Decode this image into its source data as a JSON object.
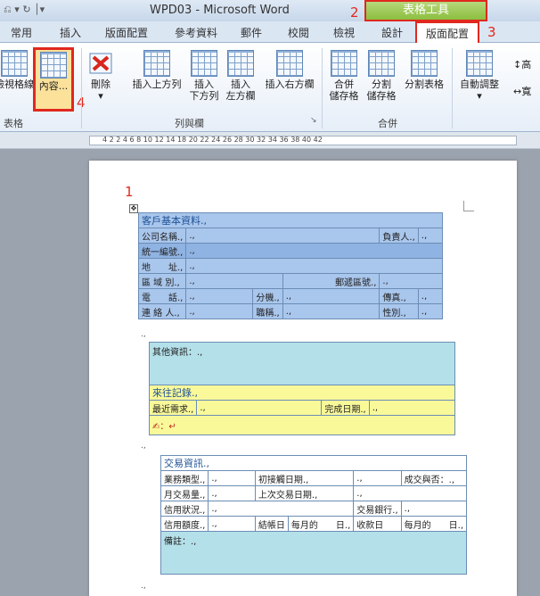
{
  "window": {
    "quick_access": "⎌ ▾ ↻ │▾",
    "title": "WPD03 - Microsoft Word",
    "tool_group_title": "表格工具"
  },
  "tabs": [
    {
      "label": "常用"
    },
    {
      "label": "插入"
    },
    {
      "label": "版面配置"
    },
    {
      "label": "參考資料"
    },
    {
      "label": "郵件"
    },
    {
      "label": "校閱"
    },
    {
      "label": "檢視"
    },
    {
      "label": "設計"
    },
    {
      "label": "版面配置"
    }
  ],
  "ribbon": {
    "view_gridlines": "檢視格線",
    "cell_content": "內容...",
    "delete": "刪除",
    "insert_above": "插入上方列",
    "insert_below_1": "插入",
    "insert_below_2": "下方列",
    "insert_left_1": "插入",
    "insert_left_2": "左方欄",
    "insert_right": "插入右方欄",
    "merge_1": "合併",
    "merge_2": "儲存格",
    "split_1": "分割",
    "split_2": "儲存格",
    "split_table": "分割表格",
    "autofit": "自動調整",
    "right_1": "高",
    "right_2": "寬",
    "group_table": "表格",
    "group_rows_cols": "列與欄",
    "group_merge": "合併"
  },
  "markers": {
    "m1": "1",
    "m2": "2",
    "m3": "3",
    "m4": "4"
  },
  "ruler": {
    "numbers": "4   2        2   4   6   8   10  12  14      18  20  22  24  26  28  30  32  34  36  38  40  42"
  },
  "doc": {
    "table1": {
      "title": "客戶基本資料.,",
      "company": "公司名稱.,",
      "owner": "負責人.,",
      "taxid": "統一編號.,",
      "address": "地　　址.,",
      "region": "區  域  別.,",
      "zip": "郵遞區號.,",
      "phone": "電　　話.,",
      "ext": "分機.,",
      "fax": "傳真.,",
      "contact": "連  絡  人.,",
      "title_job": "職稱.,",
      "gender": "性別.,",
      "cell": ".,"
    },
    "table2": {
      "other": "其他資訊：.,",
      "records": "來往記錄.,",
      "recent": "最近需求.,",
      "done_date": "完成日期.,",
      "note": "✍：↵",
      "cell": ".,"
    },
    "table3": {
      "title": "交易資訊.,",
      "biz_type": "業務類型.,",
      "first_date": "初接觸日期.,",
      "deal": "成交與否：.,",
      "monthly": "月交易量.,",
      "last_date": "上次交易日期.,",
      "credit_status": "信用狀況.,",
      "bank": "交易銀行.,",
      "credit_limit": "信用額度.,",
      "close_date": "結帳日",
      "month_day_1": "每月的　　日.,",
      "pay_date": "收款日",
      "month_day_2": "每月的　　日.,",
      "remark": "備註：.,",
      "cell": ".,"
    },
    "para_mark": ".,"
  }
}
